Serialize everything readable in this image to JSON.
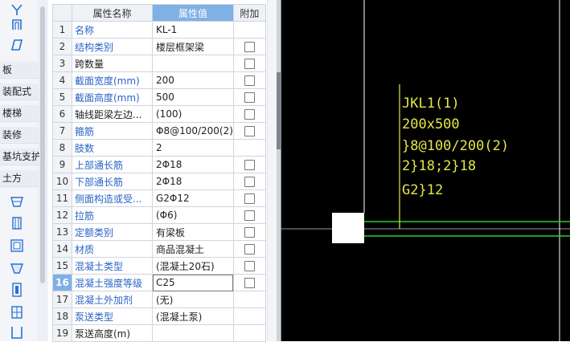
{
  "left_toolbar": {
    "top_icons": [
      "beam-select-icon",
      "arch-beam-icon",
      "parallelogram-icon"
    ],
    "categories": [
      "板",
      "装配式",
      "楼梯",
      "装修",
      "基坑支护",
      "土方"
    ],
    "bottom_icons": [
      "pit-icon",
      "trench-icon",
      "square-pit-icon",
      "slope-pit-icon",
      "column-footing-icon",
      "grid-box-icon",
      "container-icon"
    ]
  },
  "properties": {
    "headers": {
      "num": "",
      "name": "属性名称",
      "value": "属性值",
      "add": "附加"
    },
    "rows": [
      {
        "num": "1",
        "name": "名称",
        "value": "KL-1",
        "blue": true,
        "checkbox": false
      },
      {
        "num": "2",
        "name": "结构类别",
        "value": "楼层框架梁",
        "blue": true,
        "checkbox": true
      },
      {
        "num": "3",
        "name": "跨数量",
        "value": "",
        "blue": false,
        "checkbox": true
      },
      {
        "num": "4",
        "name": "截面宽度(mm)",
        "value": "200",
        "blue": true,
        "checkbox": true
      },
      {
        "num": "5",
        "name": "截面高度(mm)",
        "value": "500",
        "blue": true,
        "checkbox": true
      },
      {
        "num": "6",
        "name": "轴线距梁左边...",
        "value": "(100)",
        "blue": false,
        "checkbox": true
      },
      {
        "num": "7",
        "name": "箍筋",
        "value": "Φ8@100/200(2)",
        "blue": true,
        "checkbox": true
      },
      {
        "num": "8",
        "name": "肢数",
        "value": "2",
        "blue": true,
        "checkbox": false
      },
      {
        "num": "9",
        "name": "上部通长筋",
        "value": "2Φ18",
        "blue": true,
        "checkbox": true
      },
      {
        "num": "10",
        "name": "下部通长筋",
        "value": "2Φ18",
        "blue": true,
        "checkbox": true
      },
      {
        "num": "11",
        "name": "侧面构造或受...",
        "value": "G2Φ12",
        "blue": true,
        "checkbox": true
      },
      {
        "num": "12",
        "name": "拉筋",
        "value": "(Φ6)",
        "blue": true,
        "checkbox": true
      },
      {
        "num": "13",
        "name": "定额类别",
        "value": "有梁板",
        "blue": true,
        "checkbox": true
      },
      {
        "num": "14",
        "name": "材质",
        "value": "商品混凝土",
        "blue": true,
        "checkbox": true
      },
      {
        "num": "15",
        "name": "混凝土类型",
        "value": "(混凝土20石)",
        "blue": true,
        "checkbox": true
      },
      {
        "num": "16",
        "name": "混凝土强度等级",
        "value": "C25",
        "blue": true,
        "checkbox": true
      },
      {
        "num": "17",
        "name": "混凝土外加剂",
        "value": "(无)",
        "blue": true,
        "checkbox": false
      },
      {
        "num": "18",
        "name": "泵送类型",
        "value": "(混凝土泵)",
        "blue": true,
        "checkbox": false
      },
      {
        "num": "19",
        "name": "泵送高度(m)",
        "value": "",
        "blue": false,
        "checkbox": false
      }
    ],
    "selected_row": "16"
  },
  "cad_annotation": {
    "lines": [
      "JKL1(1)",
      "200x500",
      "}8@100/200(2)",
      "2}18;2}18",
      "G2}12"
    ]
  },
  "colors": {
    "header_accent": "#7fb0e6",
    "label_blue": "#2a64c6",
    "cad_text": "#e6e64a",
    "cad_beam": "#2ad02a",
    "cad_column": "#ffffff"
  }
}
